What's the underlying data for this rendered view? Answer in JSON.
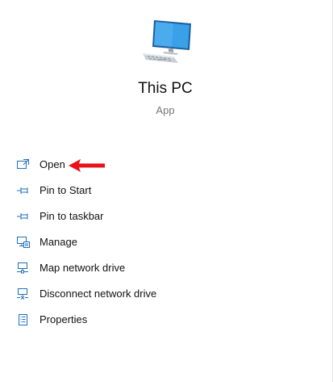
{
  "app": {
    "title": "This PC",
    "type": "App",
    "icon": "computer-monitor-icon"
  },
  "menu": {
    "items": [
      {
        "label": "Open",
        "icon": "open-window-icon"
      },
      {
        "label": "Pin to Start",
        "icon": "pin-icon"
      },
      {
        "label": "Pin to taskbar",
        "icon": "pin-icon"
      },
      {
        "label": "Manage",
        "icon": "computer-manage-icon"
      },
      {
        "label": "Map network drive",
        "icon": "network-drive-icon"
      },
      {
        "label": "Disconnect network drive",
        "icon": "disconnect-network-drive-icon"
      },
      {
        "label": "Properties",
        "icon": "properties-icon"
      }
    ]
  },
  "annotation": {
    "arrow_color": "#e8121b",
    "points_to": "Open"
  },
  "colors": {
    "icon_accent": "#1f6fb8",
    "monitor_screen": "#3aa0e8"
  }
}
